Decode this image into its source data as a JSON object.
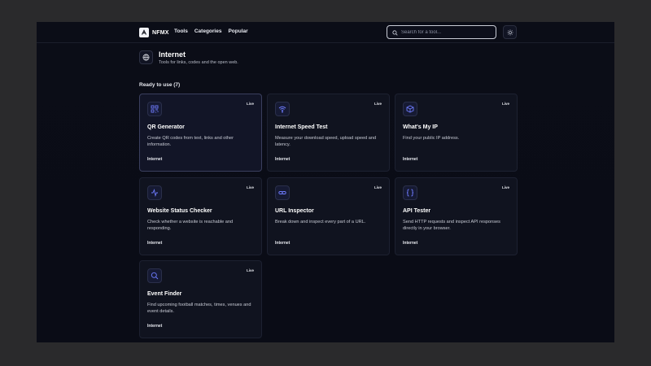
{
  "header": {
    "brand": "NFMX",
    "nav": [
      "Tools",
      "Categories",
      "Popular"
    ],
    "search_placeholder": "Search for a tool..."
  },
  "category": {
    "title": "Internet",
    "description": "Tools for links, codes and the open web.",
    "section_label": "Ready to use (7)"
  },
  "tools": [
    {
      "title": "QR Generator",
      "description": "Create QR codes from text, links and other information.",
      "tag": "Internet",
      "badge": "Live",
      "icon": "qr-code-icon"
    },
    {
      "title": "Internet Speed Test",
      "description": "Measure your download speed, upload speed and latency.",
      "tag": "Internet",
      "badge": "Live",
      "icon": "wifi-icon"
    },
    {
      "title": "What's My IP",
      "description": "Find your public IP address.",
      "tag": "Internet",
      "badge": "Live",
      "icon": "cube-icon"
    },
    {
      "title": "Website Status Checker",
      "description": "Check whether a website is reachable and responding.",
      "tag": "Internet",
      "badge": "Live",
      "icon": "activity-icon"
    },
    {
      "title": "URL Inspector",
      "description": "Break down and inspect every part of a URL.",
      "tag": "Internet",
      "badge": "Live",
      "icon": "link-icon"
    },
    {
      "title": "API Tester",
      "description": "Send HTTP requests and inspect API responses directly in your browser.",
      "tag": "Internet",
      "badge": "Live",
      "icon": "braces-icon"
    },
    {
      "title": "Event Finder",
      "description": "Find upcoming football matches, times, venues and event details.",
      "tag": "Internet",
      "badge": "Live",
      "icon": "search-icon"
    }
  ],
  "colors": {
    "background": "#0b0d17",
    "card": "#10131f",
    "accent_icon": "#6f7cff"
  }
}
